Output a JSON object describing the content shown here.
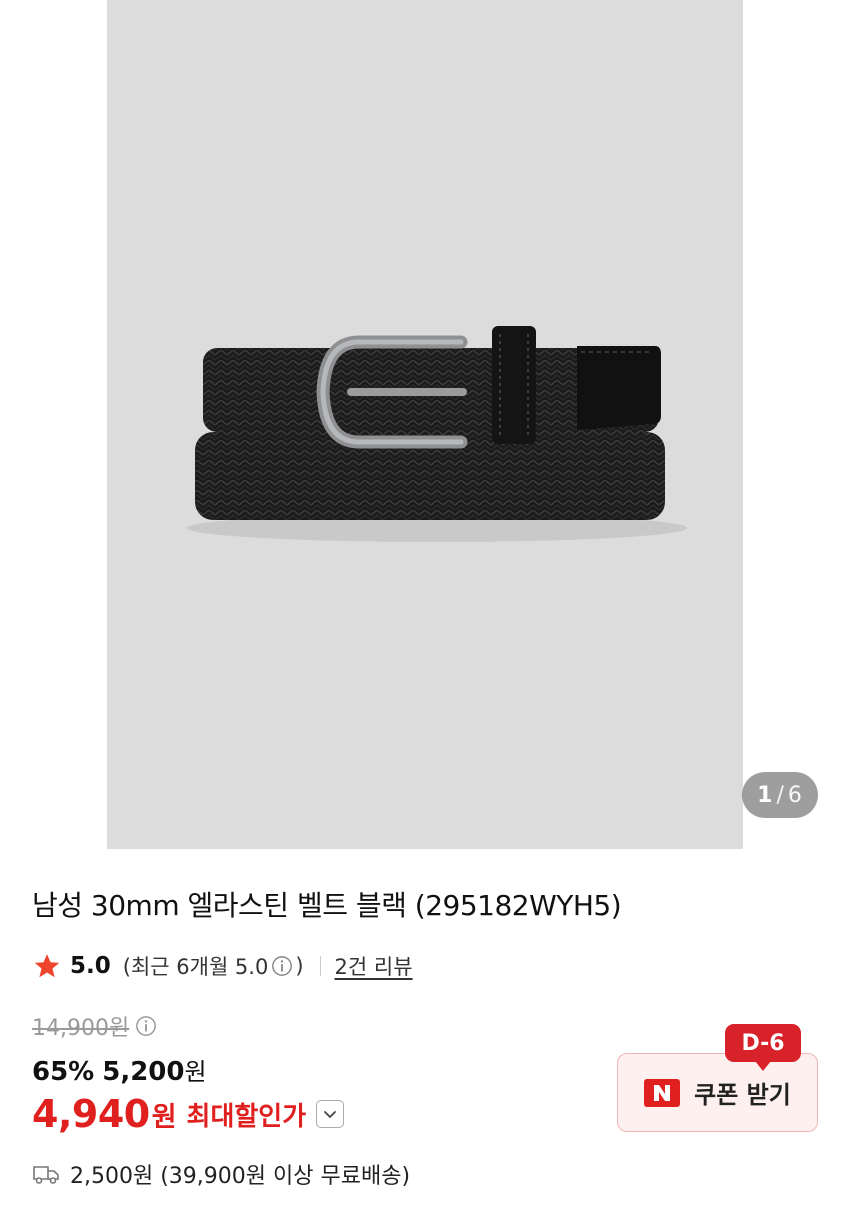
{
  "gallery": {
    "current": "1",
    "separator": "/",
    "total": "6"
  },
  "product": {
    "title": "남성 30mm 엘라스틴 벨트 블랙 (295182WYH5)",
    "rating": "5.0",
    "recent_rating": "(최근 6개월 5.0",
    "recent_close": ")",
    "reviews": "2건 리뷰",
    "original_price": "14,900원",
    "discount_percent": "65%",
    "sale_price": "5,200",
    "sale_unit": "원",
    "max_price": "4,940",
    "max_unit": "원",
    "max_label": "최대할인가",
    "coupon_dday": "D-6",
    "coupon_label": "쿠폰 받기",
    "shipping": "2,500원 (39,900원 이상 무료배송)"
  },
  "colors": {
    "accent": "#e0201f",
    "star": "#f0452d",
    "coupon_bg": "#fdf0ef"
  },
  "icons": [
    "star-icon",
    "info-icon",
    "chevron-down-icon",
    "naver-logo-icon",
    "truck-icon"
  ]
}
